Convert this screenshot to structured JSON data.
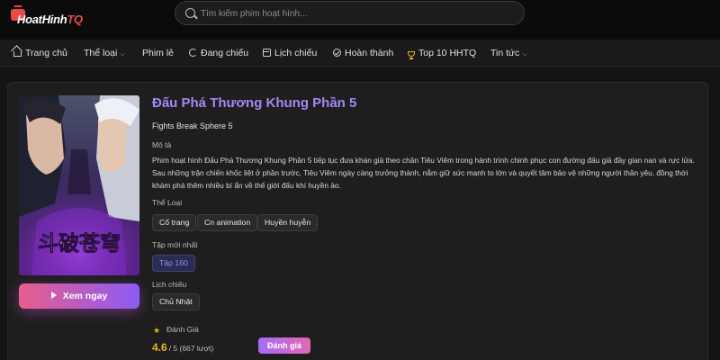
{
  "header": {
    "logo_main": "HoatHinh",
    "logo_accent": "TQ",
    "search_placeholder": "Tìm kiếm phim hoạt hình..."
  },
  "nav": {
    "home": "Trang chủ",
    "genre": "Thể loại",
    "single": "Phim lẻ",
    "airing": "Đang chiếu",
    "schedule": "Lịch chiếu",
    "completed": "Hoàn thành",
    "top10": "Top 10 HHTQ",
    "news": "Tin tức"
  },
  "movie": {
    "title": "Đấu Phá Thương Khung Phần 5",
    "subtitle": "Fights Break Sphere 5",
    "description_label": "Mô tả",
    "description": "Phim hoạt hình Đấu Phá Thương Khung Phần 5 tiếp tục đưa khán giả theo chân Tiêu Viêm trong hành trình chinh phục con đường đấu giả đầy gian nan và rực lửa. Sau những trận chiến khốc liệt ở phần trước, Tiêu Viêm ngày càng trưởng thành, nắm giữ sức mạnh to lớn và quyết tâm bảo vệ những người thân yêu, đồng thời khám phá thêm nhiều bí ẩn về thế giới đấu khí huyền ảo.",
    "genre_label": "Thể Loại",
    "genres": [
      "Cổ trang",
      "Cn animation",
      "Huyền huyễn"
    ],
    "latest_label": "Tập mới nhất",
    "latest_episode": "Tập 160",
    "schedule_label": "Lịch chiếu",
    "schedule_day": "Chủ Nhật",
    "rating_label": "Đánh Giá",
    "rating_score": "4.6",
    "rating_rest": "/ 5 (667 lượt)",
    "rate_button": "Đánh giá",
    "watch_button": "Xem ngay",
    "poster_text": "斗破苍穹"
  },
  "colors": {
    "accent_purple": "#a586f5",
    "star_gold": "#e6b422",
    "brand_red": "#e84a4a"
  }
}
